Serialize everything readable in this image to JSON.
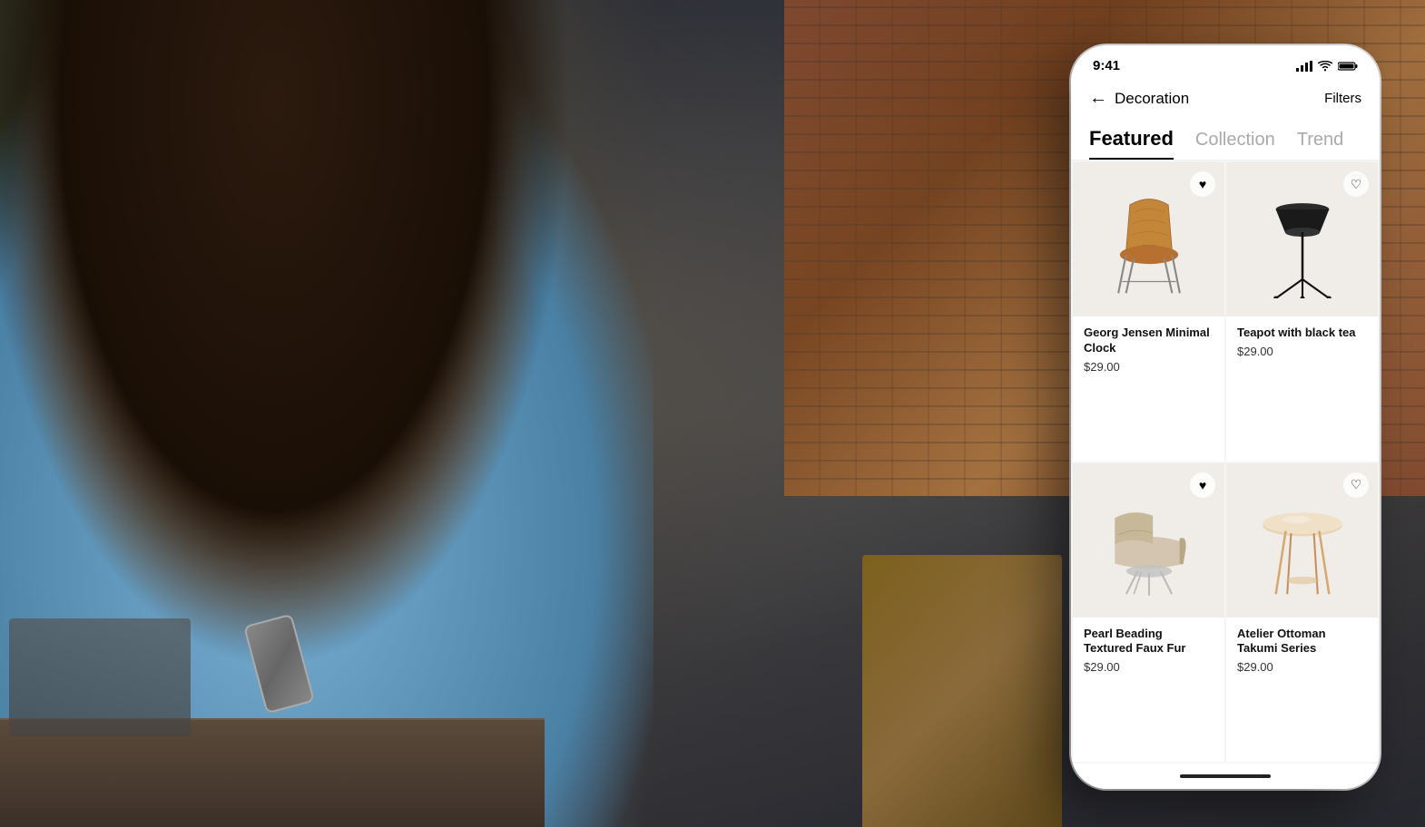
{
  "background": {
    "alt": "Woman sitting with phone in industrial setting"
  },
  "phone": {
    "status_bar": {
      "time": "9:41",
      "signal": "▐▐▐",
      "wifi": "WiFi",
      "battery": "Battery"
    },
    "nav": {
      "back_label": "←",
      "title": "Decoration",
      "filters_label": "Filters"
    },
    "tabs": [
      {
        "label": "Featured",
        "active": true
      },
      {
        "label": "Collection",
        "active": false
      },
      {
        "label": "Trend",
        "active": false,
        "cut_off": true
      }
    ],
    "products": [
      {
        "name": "Georg Jensen Minimal Clock",
        "price": "$29.00",
        "favorited": true,
        "heart": "♥"
      },
      {
        "name": "Teapot with black tea",
        "price": "$29.00",
        "favorited": false,
        "heart": "♡"
      },
      {
        "name": "Pearl Beading Textured Faux Fur",
        "price": "$29.00",
        "favorited": true,
        "heart": "♥"
      },
      {
        "name": "Atelier Ottoman Takumi Series",
        "price": "$29.00",
        "favorited": false,
        "heart": "♡"
      }
    ],
    "home_indicator": true
  }
}
